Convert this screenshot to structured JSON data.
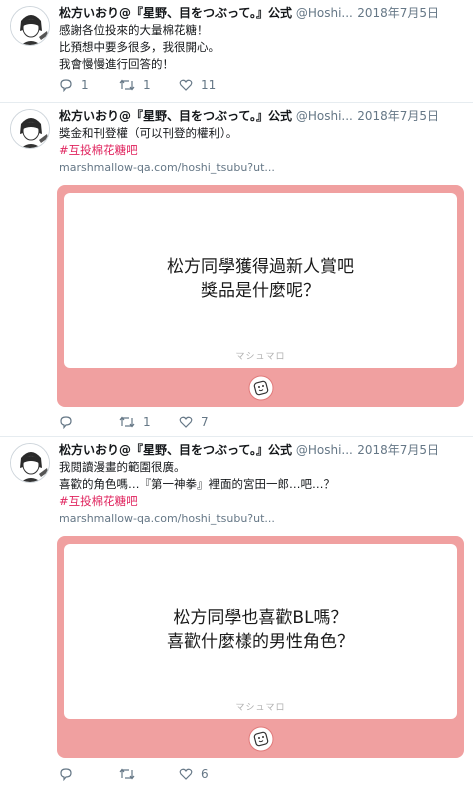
{
  "colors": {
    "card_bg": "#f0a0a0",
    "hashtag": "#e0245e",
    "muted": "#657786"
  },
  "tweets": [
    {
      "name": "松方いおり@『星野、目をつぶって。』公式",
      "handle": "@Hoshi...",
      "date": "2018年7月5日",
      "lines": [
        "感謝各位投來的大量棉花糖！",
        "比預想中要多很多，我很開心。",
        "我會慢慢進行回答的！"
      ],
      "replies": "1",
      "retweets": "1",
      "likes": "11"
    },
    {
      "name": "松方いおり@『星野、目をつぶって。』公式",
      "handle": "@Hoshi...",
      "date": "2018年7月5日",
      "lines": [
        "獎金和刊登權（可以刊登的權利）。"
      ],
      "hashtag": "#互投棉花糖吧",
      "link": "marshmallow-qa.com/hoshi_tsubu?ut...",
      "card_lines": [
        "松方同學獲得過新人賞吧",
        "獎品是什麼呢？"
      ],
      "card_brand": "マシュマロ",
      "replies": "",
      "retweets": "1",
      "likes": "7"
    },
    {
      "name": "松方いおり@『星野、目をつぶって。』公式",
      "handle": "@Hoshi...",
      "date": "2018年7月5日",
      "lines": [
        "我閱讀漫畫的範圍很廣。",
        "喜歡的角色嗎…『第一神拳』裡面的宮田一郎…吧…？"
      ],
      "hashtag": "#互投棉花糖吧",
      "link": "marshmallow-qa.com/hoshi_tsubu?ut...",
      "card_lines": [
        "松方同學也喜歡BL嗎？",
        "喜歡什麼樣的男性角色？"
      ],
      "card_brand": "マシュマロ",
      "replies": "",
      "retweets": "",
      "likes": "6"
    }
  ]
}
